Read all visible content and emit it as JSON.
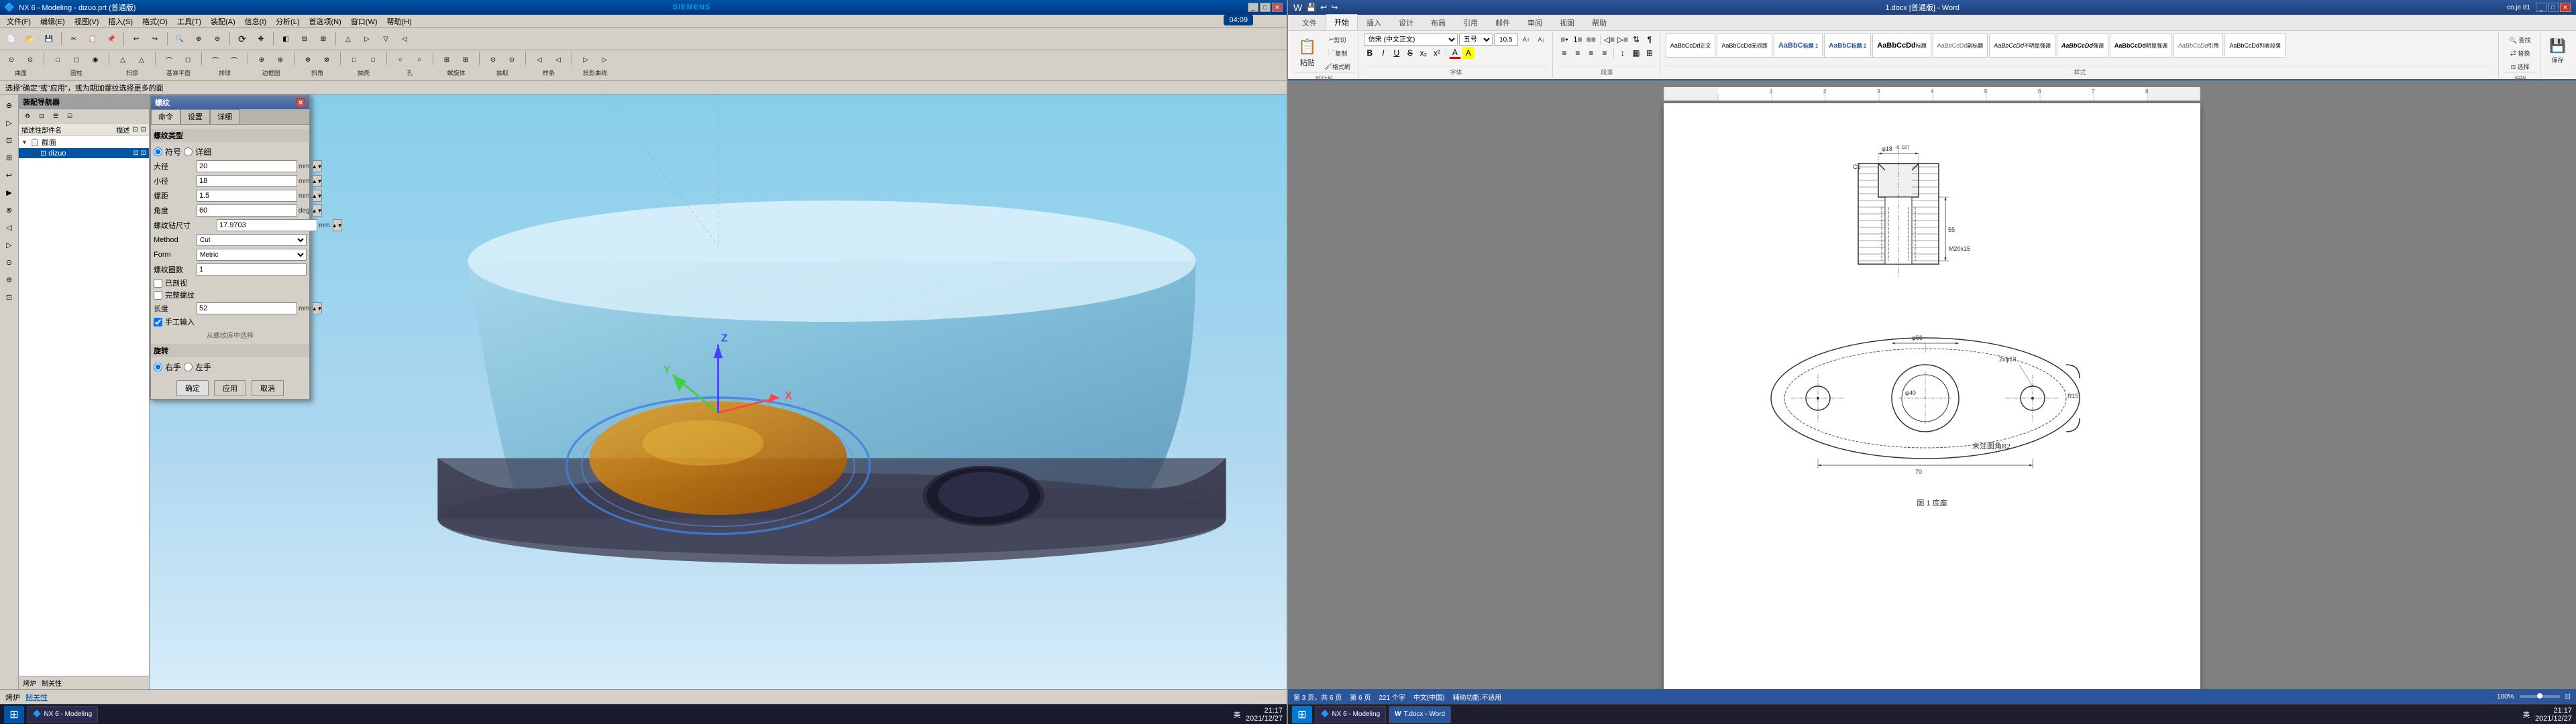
{
  "nx": {
    "title": "NX 6 - Modeling - dizuo.prt (普通版)",
    "siemens_label": "SIEMENS",
    "time_badge": "04:09",
    "prompt": "选择\"确定\"或\"应用\"，或为期加螺纹选择更多的面",
    "menubar": [
      "文件(F)",
      "编辑(E)",
      "视图(V)",
      "插入(S)",
      "格式(O)",
      "工具(T)",
      "装配(A)",
      "信息(I)",
      "分析(L)",
      "首选项(N)",
      "窗口(W)",
      "帮助(H)"
    ],
    "toolbar1_items": [
      "▶",
      "📂",
      "💾",
      "✂",
      "📋",
      "↩",
      "↪",
      "🔍",
      "+",
      "-",
      "⊞",
      "◻",
      "◻",
      "◻",
      "△",
      "⊕",
      "⊙",
      "◻",
      "M",
      "⊡",
      "⊗"
    ],
    "toolbar2_groups": [
      {
        "icons": [
          "⊙",
          "⊙"
        ],
        "label": "曲面"
      },
      {
        "icons": [
          "□",
          "□"
        ],
        "label": "圆柱"
      },
      {
        "icons": [
          "△",
          "△"
        ],
        "label": "扫掠"
      },
      {
        "icons": [
          "⌒",
          "◻"
        ],
        "label": "基准平面"
      },
      {
        "icons": [
          "⌒",
          "⌒"
        ],
        "label": "排球"
      },
      {
        "icons": [
          "⊕",
          "⊕"
        ],
        "label": "边框图"
      },
      {
        "icons": [
          "⊗",
          "⊗"
        ],
        "label": "斜角"
      },
      {
        "icons": [
          "□",
          "□"
        ],
        "label": "抽壳"
      },
      {
        "icons": [
          "○",
          "○"
        ],
        "label": "孔"
      },
      {
        "icons": [
          "⊞",
          "⊞"
        ],
        "label": "螺旋体"
      },
      {
        "icons": [
          "⊙",
          "⊙"
        ],
        "label": "抽取"
      },
      {
        "icons": [
          "◁",
          "◁"
        ],
        "label": "样条"
      },
      {
        "icons": [
          "▷",
          "▷"
        ],
        "label": "投影曲线"
      }
    ],
    "navigator": {
      "title": "装配导航器",
      "tabs": [
        "♻",
        "⊡",
        "☰",
        "☑"
      ],
      "columns": [
        "描述性部件名",
        "描述",
        "⊡",
        "⊡"
      ],
      "items": [
        {
          "level": 0,
          "expand": "▼",
          "icon": "📋",
          "name": "截面"
        },
        {
          "level": 1,
          "expand": "▼",
          "icon": "⊡",
          "name": "dizuo"
        }
      ]
    },
    "left_tools": [
      "⊕",
      "▷",
      "⊡",
      "⊞",
      "↩",
      "▶",
      "⊗",
      "◁",
      "▷",
      "⊙",
      "⊕",
      "⊡"
    ],
    "dialog": {
      "title": "螺纹",
      "tabs": [
        "命令",
        "设置",
        "详细"
      ],
      "active_tab": "命令",
      "fields": {
        "大径_label": "大径",
        "大径_value": "20",
        "大径_unit": "mm",
        "小径_label": "小径",
        "小径_value": "18",
        "小径_unit": "mm",
        "螺距_label": "螺距",
        "螺距_value": "1.5",
        "螺距_unit": "mm",
        "角度_label": "角度",
        "角度_value": "60",
        "角度_unit": "deg",
        "螺纹钻尺寸_label": "螺纹钻尺寸",
        "螺纹钻尺寸_value": "17.9703",
        "螺纹钻尺寸_unit": "mm",
        "method_label": "Method",
        "method_value": "Cut",
        "form_label": "Form",
        "form_value": "Metric",
        "螺纹圈数_label": "螺纹圈数",
        "螺纹圈数_value": "1",
        "已剖视_label": "□ 已剖视",
        "完整螺纹_label": "□ 完整螺纹",
        "长度_label": "长度",
        "长度_value": "52",
        "长度_unit": "mm",
        "手工输入_label": "☑ 手工输入",
        "section_旋转": "旋转",
        "right_label": "右手",
        "left_label": "左手"
      },
      "buttons": {
        "ok": "确定",
        "apply": "应用",
        "cancel": "取消"
      }
    },
    "statusbar": {
      "part_label": "烤炉",
      "link_text": "制关性",
      "time": "21:17",
      "date": "2021/12/27"
    }
  },
  "word": {
    "title": "1.docx [普通版] - Word",
    "title_center": "T.docx [普通版] - Word",
    "user": "co.je 81",
    "tabs": [
      "文件",
      "开始",
      "插入",
      "设计",
      "布局",
      "引用",
      "邮件",
      "审阅",
      "视图",
      "帮助"
    ],
    "active_tab": "开始",
    "ribbon": {
      "clipboard": {
        "label": "剪贴板",
        "paste_label": "粘贴",
        "cut_label": "剪切",
        "copy_label": "复制",
        "format_label": "格式刷"
      },
      "font": {
        "label": "字体",
        "font_name": "仿宋 (中文正文)",
        "font_size": "五号",
        "font_size_num": "10.5",
        "bold": "B",
        "italic": "I",
        "underline": "U",
        "strikethrough": "S",
        "subscript": "x₂",
        "superscript": "x²",
        "color_btn": "A"
      },
      "paragraph": {
        "label": "段落",
        "bullets": "≡",
        "numbering": "≡",
        "outdent": "◁",
        "indent": "▷",
        "sort": "⇅",
        "show_marks": "¶",
        "align_left": "≡",
        "align_center": "≡",
        "align_right": "≡",
        "justify": "≡",
        "line_spacing": "↕",
        "shading": "▦",
        "borders": "⊞"
      },
      "styles_label": "样式",
      "styles": [
        {
          "name": "正文",
          "class": "normal"
        },
        {
          "name": "标题 1",
          "class": "heading1"
        },
        {
          "name": "标题 2",
          "class": "heading2"
        },
        {
          "name": "AaBbCcDd",
          "class": "normal"
        },
        {
          "name": "AaBbCcDd",
          "class": "normal"
        },
        {
          "name": "AaBbCcDd",
          "class": "normal"
        },
        {
          "name": "AaBbCcDd",
          "class": "normal"
        },
        {
          "name": "AaBbCcDd",
          "class": "normal"
        },
        {
          "name": "AaBbCcDd",
          "class": "normal"
        },
        {
          "name": "AaBbCcDd",
          "class": "normal"
        },
        {
          "name": "AaBbCcDd",
          "class": "normal"
        },
        {
          "name": "AaBbCcDd",
          "class": "normal"
        }
      ],
      "editing_label": "编辑",
      "save_label": "保存"
    },
    "document": {
      "page_info": "第 3 页，共 6 页",
      "word_count": "221 个字",
      "language": "中文(中国)",
      "input_method": "辅助功能:不适用",
      "zoom": "100%",
      "caption_top": "",
      "caption_bottom": "图 1 底座",
      "drawing_dims": {
        "top_dim1": "φ18-0.027",
        "top_dim2": "C1",
        "side_dim1": "55",
        "side_dim2": "M20x15",
        "bottom_dim1": "φ40",
        "bottom_dim2": "φ56",
        "bottom_dim3": "R15",
        "bottom_dim4": "2xφ13",
        "bottom_dim5": "70",
        "corner_note": "未注圆角R2."
      }
    },
    "statusbar": {
      "page": "第 3 页，共 6 页",
      "words": "第 6 页",
      "word_count": "221 个字",
      "lang": "中文(中国)",
      "accessibility": "辅助功能:不适用",
      "zoom_pct": "100%",
      "time": "21:17",
      "date": "2021/12/27"
    },
    "taskbar_items": [
      "⊞",
      "W",
      "W"
    ]
  }
}
